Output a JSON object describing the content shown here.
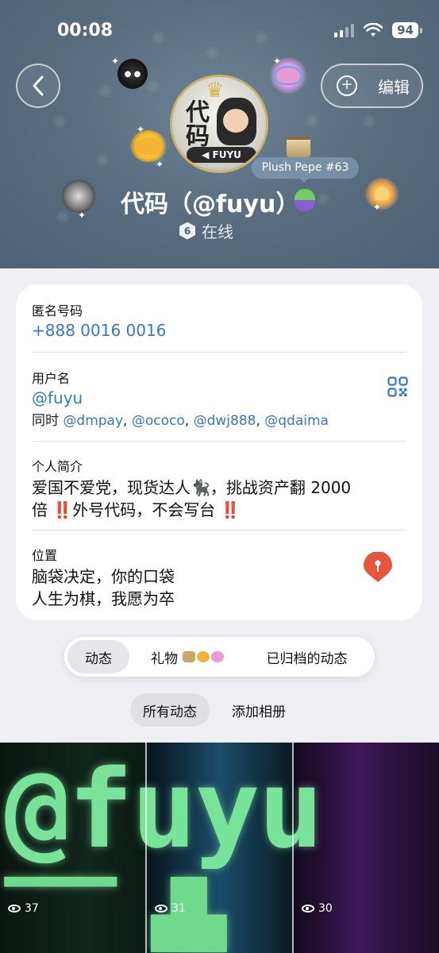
{
  "status_bar": {
    "time": "00:08",
    "battery": "94"
  },
  "header": {
    "back_icon": "chevron-left-icon",
    "edit_label": "编辑",
    "avatar_text": "代码",
    "avatar_banner": "◀ FUYU",
    "gift_tooltip": "Plush Pepe #63",
    "display_name": "代码（@fuyu）",
    "online_level": "6",
    "online_status": "在线"
  },
  "info": {
    "anon_number_label": "匿名号码",
    "anon_number": "+888 0016 0016",
    "username_label": "用户名",
    "username": "@fuyu",
    "also_prefix": "同时",
    "also_usernames": [
      "@dmpay",
      "@ococo",
      "@dwj888",
      "@qdaima"
    ],
    "bio_label": "个人简介",
    "bio_line1": "爱国不爱党，现货达人🐈‍⬛，挑战资产翻 2000",
    "bio_line2": "倍 ‼️外号代码，不会写台 ‼️",
    "location_label": "位置",
    "location_line1": "脑袋决定，你的口袋",
    "location_line2": "人生为棋，我愿为卒"
  },
  "tabs": [
    {
      "label": "动态",
      "active": true
    },
    {
      "label": "礼物",
      "active": false
    },
    {
      "label": "已归档的动态",
      "active": false
    }
  ],
  "subtabs": [
    {
      "label": "所有动态",
      "active": true
    },
    {
      "label": "添加相册",
      "active": false
    }
  ],
  "grid": {
    "banner_text": "@fuyu",
    "views": [
      "37",
      "31",
      "30"
    ]
  },
  "colors": {
    "header_bg": "#566b7d",
    "link": "#3478c8",
    "code_green": "#79e39a",
    "pin_red": "#e8553f"
  }
}
